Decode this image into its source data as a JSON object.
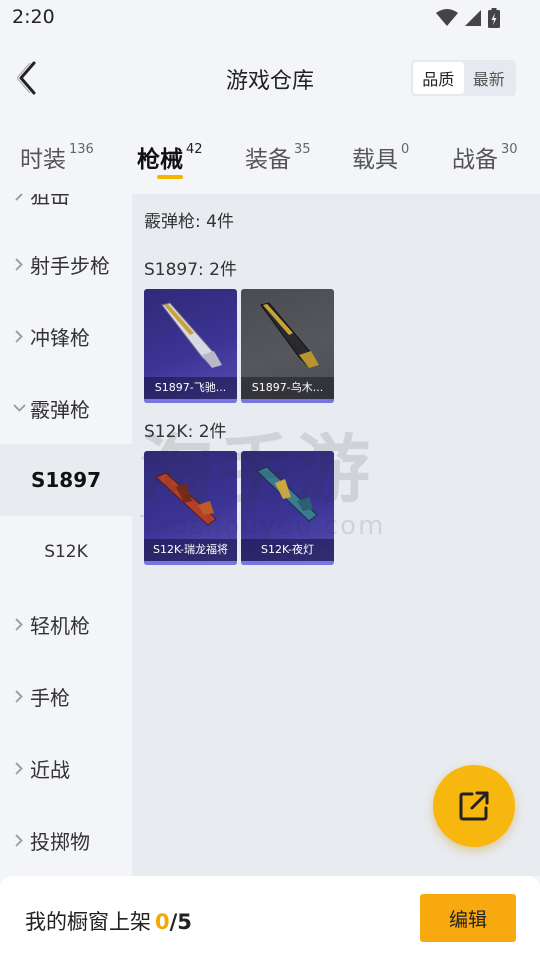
{
  "status_bar": {
    "time": "2:20",
    "icons": [
      "wifi-icon",
      "cell-signal-icon",
      "battery-icon"
    ]
  },
  "header": {
    "title": "游戏仓库",
    "back_icon": "back-chevron-icon",
    "sort": {
      "quality": "品质",
      "newest": "最新",
      "selected": "品质"
    }
  },
  "tabs": [
    {
      "label": "时装",
      "count": "136",
      "active": false
    },
    {
      "label": "枪械",
      "count": "42",
      "active": true
    },
    {
      "label": "装备",
      "count": "35",
      "active": false
    },
    {
      "label": "载具",
      "count": "0",
      "active": false
    },
    {
      "label": "战备",
      "count": "30",
      "active": false
    }
  ],
  "sidebar": {
    "items": [
      {
        "label": "狙击",
        "partial": true
      },
      {
        "label": "射手步枪"
      },
      {
        "label": "冲锋枪"
      },
      {
        "label": "霰弹枪",
        "expanded": true
      },
      {
        "label": "S1897",
        "sub": true,
        "active": true
      },
      {
        "label": "S12K",
        "sub": true
      },
      {
        "label": "轻机枪"
      },
      {
        "label": "手枪"
      },
      {
        "label": "近战"
      },
      {
        "label": "投掷物"
      }
    ]
  },
  "content": {
    "category_heading": "霰弹枪: 4件",
    "groups": [
      {
        "heading": "S1897: 2件",
        "items": [
          {
            "name": "S1897-飞驰...",
            "rarity_color": "#3b3495"
          },
          {
            "name": "S1897-乌木...",
            "rarity_color": "#55575d"
          }
        ]
      },
      {
        "heading": "S12K: 2件",
        "items": [
          {
            "name": "S12K-瑞龙福将",
            "rarity_color": "#3b3495"
          },
          {
            "name": "S12K-夜灯",
            "rarity_color": "#3b3495"
          }
        ]
      }
    ]
  },
  "watermark": {
    "cn": "淘手游",
    "en": "Taoshouyou.com"
  },
  "fab": {
    "icon": "share-external-icon"
  },
  "bottom_bar": {
    "showcase_label": "我的橱窗上架",
    "showcase_current": "0",
    "showcase_total": "/5",
    "edit_label": "编辑"
  },
  "colors": {
    "accent": "#f5b400",
    "fab": "#f7b70f",
    "edit_button": "#f7a90f"
  }
}
